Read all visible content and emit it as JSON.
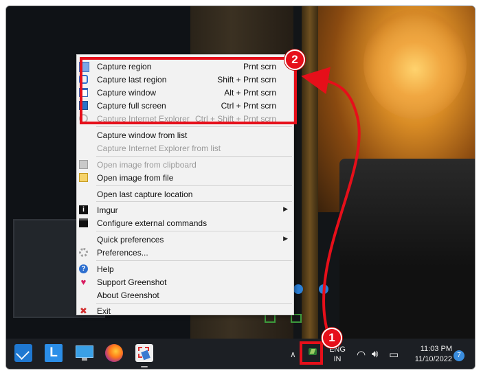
{
  "menu": {
    "items": [
      {
        "label": "Capture region",
        "shortcut": "Prnt scrn",
        "icon": "region-icon"
      },
      {
        "label": "Capture last region",
        "shortcut": "Shift + Prnt scrn",
        "icon": "last-region-icon"
      },
      {
        "label": "Capture window",
        "shortcut": "Alt + Prnt scrn",
        "icon": "window-icon"
      },
      {
        "label": "Capture full screen",
        "shortcut": "Ctrl + Prnt scrn",
        "icon": "monitor-icon"
      },
      {
        "label": "Capture Internet Explorer",
        "shortcut": "Ctrl + Shift + Prnt scrn",
        "icon": "ie-icon",
        "disabled": true
      },
      {
        "label": "Capture window from list"
      },
      {
        "label": "Capture Internet Explorer from list",
        "disabled": true
      },
      {
        "label": "Open image from clipboard",
        "icon": "clipboard-icon",
        "disabled": true
      },
      {
        "label": "Open image from file",
        "icon": "open-file-icon"
      },
      {
        "label": "Open last capture location"
      },
      {
        "label": "Imgur",
        "icon": "imgur-icon",
        "submenu": true
      },
      {
        "label": "Configure external commands",
        "icon": "terminal-icon"
      },
      {
        "label": "Quick preferences",
        "submenu": true
      },
      {
        "label": "Preferences...",
        "icon": "gear-icon"
      },
      {
        "label": "Help",
        "icon": "help-icon"
      },
      {
        "label": "Support Greenshot",
        "icon": "heart-icon"
      },
      {
        "label": "About Greenshot"
      },
      {
        "label": "Exit",
        "icon": "exit-icon"
      }
    ]
  },
  "taskbar": {
    "apps": [
      "mail",
      "L",
      "this-pc",
      "firefox",
      "greenshot"
    ],
    "language_line1": "ENG",
    "language_line2": "IN",
    "time": "11:03 PM",
    "date": "11/10/2022",
    "notification_count": "7"
  },
  "annotations": {
    "badge_1": "1",
    "badge_2": "2",
    "highlight_color": "#e60f1a"
  }
}
